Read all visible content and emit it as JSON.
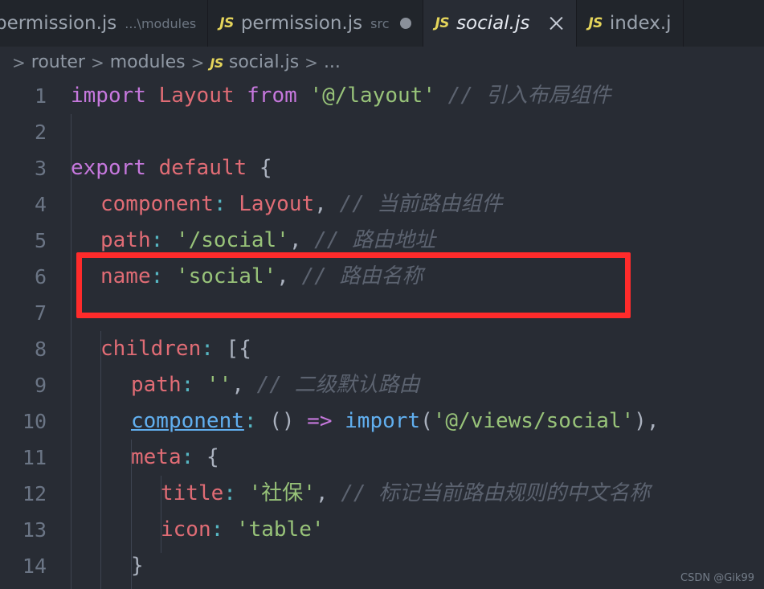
{
  "window": {
    "app": "vscode-editor",
    "background": "#282c34",
    "tabbar_background": "#21252b"
  },
  "tabs": [
    {
      "icon": "js-file-icon",
      "icon_label": "JS",
      "label": "permission.js",
      "path": "...\\modules",
      "active": false,
      "dirty": false,
      "show_icon": false,
      "show_close": false,
      "clipped": true
    },
    {
      "icon": "js-file-icon",
      "icon_label": "JS",
      "label": "permission.js",
      "path": "src",
      "active": false,
      "dirty": true,
      "show_icon": true,
      "show_close": false,
      "clipped": false
    },
    {
      "icon": "js-file-icon",
      "icon_label": "JS",
      "label": "social.js",
      "path": "",
      "active": true,
      "dirty": false,
      "show_icon": true,
      "show_close": true,
      "clipped": false
    },
    {
      "icon": "js-file-icon",
      "icon_label": "JS",
      "label": "index.j",
      "path": "",
      "active": false,
      "dirty": false,
      "show_icon": true,
      "show_close": false,
      "clipped": false
    }
  ],
  "breadcrumb": {
    "lead_separator": ">",
    "separator": ">",
    "items": [
      {
        "label": "router",
        "icon": ""
      },
      {
        "label": "modules",
        "icon": ""
      },
      {
        "label": "social.js",
        "icon": "JS"
      },
      {
        "label": "...",
        "icon": ""
      }
    ]
  },
  "editor": {
    "language": "javascript",
    "file": "social.js",
    "line_numbers": [
      "1",
      "2",
      "3",
      "4",
      "5",
      "6",
      "7",
      "8",
      "9",
      "10",
      "11",
      "12",
      "13",
      "14"
    ],
    "lines": [
      {
        "n": "1",
        "text": "import Layout from '@/layout' // 引入布局组件"
      },
      {
        "n": "2",
        "text": ""
      },
      {
        "n": "3",
        "text": "export default {"
      },
      {
        "n": "4",
        "text": "  component: Layout, // 当前路由组件"
      },
      {
        "n": "5",
        "text": "  path: '/social', // 路由地址"
      },
      {
        "n": "6",
        "text": "  name: 'social', // 路由名称"
      },
      {
        "n": "7",
        "text": ""
      },
      {
        "n": "8",
        "text": "  children: [{"
      },
      {
        "n": "9",
        "text": "    path: '', // 二级默认路由"
      },
      {
        "n": "10",
        "text": "    component: () => import('@/views/social'),"
      },
      {
        "n": "11",
        "text": "    meta: {"
      },
      {
        "n": "12",
        "text": "      title: '社保', // 标记当前路由规则的中文名称"
      },
      {
        "n": "13",
        "text": "      icon: 'table'"
      },
      {
        "n": "14",
        "text": "    }"
      }
    ],
    "tokens": {
      "l1": [
        "import",
        " ",
        "Layout",
        " ",
        "from",
        " ",
        "'@/layout'",
        " ",
        "// 引入布局组件"
      ],
      "l3": [
        "export",
        " ",
        "default",
        " ",
        "{"
      ],
      "l4": [
        "component",
        ":",
        " ",
        "Layout",
        ",",
        " ",
        "// 当前路由组件"
      ],
      "l5": [
        "path",
        ":",
        " ",
        "'/social'",
        ",",
        " ",
        "// 路由地址"
      ],
      "l6": [
        "name",
        ":",
        " ",
        "'social'",
        ",",
        " ",
        "// 路由名称"
      ],
      "l8": [
        "children",
        ":",
        " ",
        "[{"
      ],
      "l9": [
        "path",
        ":",
        " ",
        "''",
        ",",
        " ",
        "// 二级默认路由"
      ],
      "l10": [
        "component",
        ":",
        " ",
        "()",
        " ",
        "=>",
        " ",
        "import",
        "(",
        "'@/views/social'",
        ")",
        ","
      ],
      "l11": [
        "meta",
        ":",
        " ",
        "{"
      ],
      "l12": [
        "title",
        ":",
        " ",
        "'社保'",
        ",",
        " ",
        "// 标记当前路由规则的中文名称"
      ],
      "l13": [
        "icon",
        ":",
        " ",
        "'table'"
      ],
      "l14": [
        "}"
      ]
    },
    "syntax_colors": {
      "keyword": "#c678dd",
      "variable": "#e06c75",
      "string": "#98c379",
      "comment": "#5c6370",
      "punctuation": "#abb2bf",
      "operator_colon": "#56b6c2",
      "function": "#61afef",
      "line_number": "#6b7585",
      "background": "#282c34"
    }
  },
  "annotation": {
    "shape": "rectangle",
    "color": "#ff2b2b",
    "covers_lines": [
      "6",
      "7"
    ],
    "highlights_text": "name: 'social', // 路由名称"
  },
  "watermark": {
    "text": "CSDN @Gik99"
  }
}
